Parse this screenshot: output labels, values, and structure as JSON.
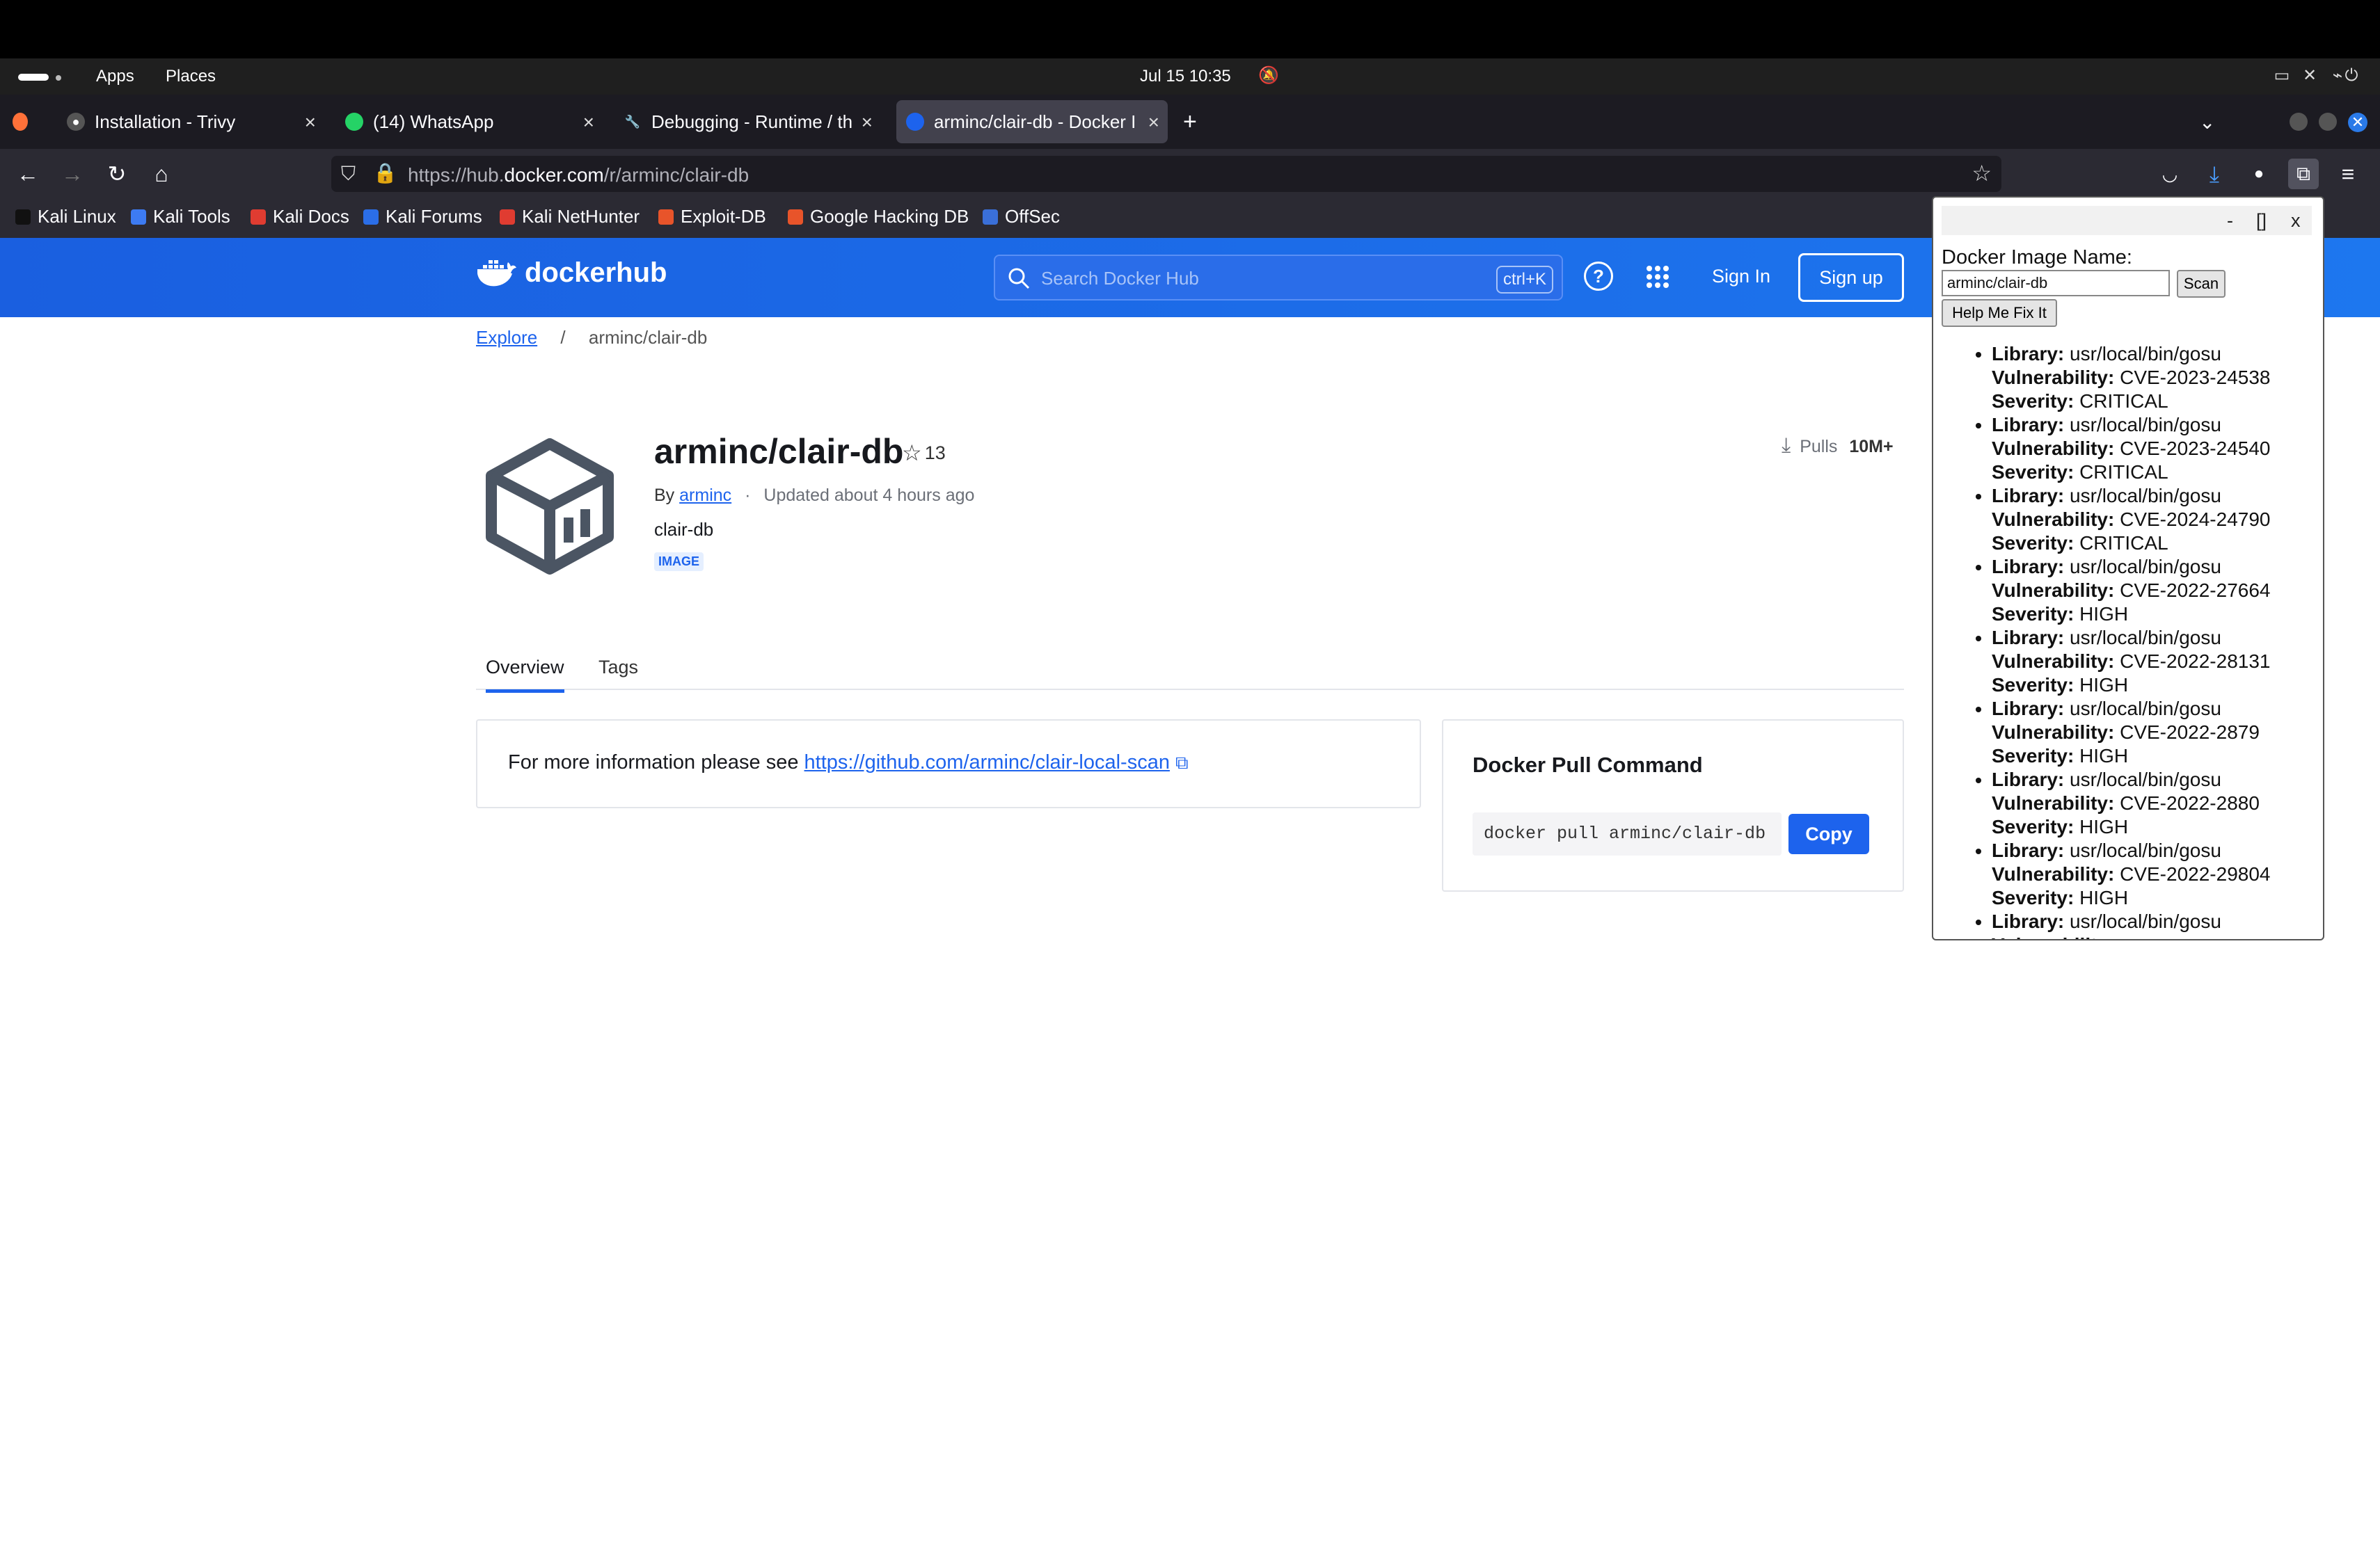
{
  "system": {
    "apps_label": "Apps",
    "places_label": "Places",
    "clock": "Jul 15  10:35"
  },
  "browser": {
    "tabs": [
      {
        "label": "Installation - Trivy"
      },
      {
        "label": "(14) WhatsApp"
      },
      {
        "label": "Debugging - Runtime / th"
      },
      {
        "label": "arminc/clair-db - Docker I"
      }
    ],
    "url_prefix": "https://hub.",
    "url_domain": "docker.com",
    "url_path": "/r/arminc/clair-db",
    "bookmarks": [
      {
        "label": "Kali Linux",
        "color": "#2b6ee8"
      },
      {
        "label": "Kali Tools",
        "color": "#3d7bf2"
      },
      {
        "label": "Kali Docs",
        "color": "#e03c31"
      },
      {
        "label": "Kali Forums",
        "color": "#2b6ee8"
      },
      {
        "label": "Kali NetHunter",
        "color": "#e03c31"
      },
      {
        "label": "Exploit-DB",
        "color": "#e8542a"
      },
      {
        "label": "Google Hacking DB",
        "color": "#e8542a"
      },
      {
        "label": "OffSec",
        "color": "#3a6fd8"
      }
    ]
  },
  "hub": {
    "brand": "dockerhub",
    "search_placeholder": "Search Docker Hub",
    "search_shortcut": "ctrl+K",
    "sign_in": "Sign In",
    "sign_up": "Sign up",
    "breadcrumb_root": "Explore",
    "breadcrumb_sep": "/",
    "breadcrumb_current": "arminc/clair-db",
    "repo_name": "arminc/clair-db",
    "stars": "13",
    "by_label": "By",
    "owner": "arminc",
    "updated": "Updated about 4 hours ago",
    "description": "clair-db",
    "badge": "IMAGE",
    "pulls_label": "Pulls",
    "pulls_value": "10M+",
    "tab_overview": "Overview",
    "tab_tags": "Tags",
    "info_prefix": "For more information please see",
    "info_link": "https://github.com/arminc/clair-local-scan",
    "pull_title": "Docker Pull Command",
    "pull_command": "docker pull arminc/clair-db",
    "copy_label": "Copy"
  },
  "extension": {
    "minimize": "-",
    "maximize": "[]",
    "close": "x",
    "label": "Docker Image Name:",
    "input_value": "arminc/clair-db",
    "scan_label": "Scan",
    "fix_label": "Help Me Fix It",
    "library_key": "Library:",
    "vuln_key": "Vulnerability:",
    "severity_key": "Severity:",
    "results": [
      {
        "library": "usr/local/bin/gosu",
        "vulnerability": "CVE-2023-24538",
        "severity": "CRITICAL"
      },
      {
        "library": "usr/local/bin/gosu",
        "vulnerability": "CVE-2023-24540",
        "severity": "CRITICAL"
      },
      {
        "library": "usr/local/bin/gosu",
        "vulnerability": "CVE-2024-24790",
        "severity": "CRITICAL"
      },
      {
        "library": "usr/local/bin/gosu",
        "vulnerability": "CVE-2022-27664",
        "severity": "HIGH"
      },
      {
        "library": "usr/local/bin/gosu",
        "vulnerability": "CVE-2022-28131",
        "severity": "HIGH"
      },
      {
        "library": "usr/local/bin/gosu",
        "vulnerability": "CVE-2022-2879",
        "severity": "HIGH"
      },
      {
        "library": "usr/local/bin/gosu",
        "vulnerability": "CVE-2022-2880",
        "severity": "HIGH"
      },
      {
        "library": "usr/local/bin/gosu",
        "vulnerability": "CVE-2022-29804",
        "severity": "HIGH"
      },
      {
        "library": "usr/local/bin/gosu",
        "vulnerability": "",
        "severity": ""
      }
    ]
  }
}
